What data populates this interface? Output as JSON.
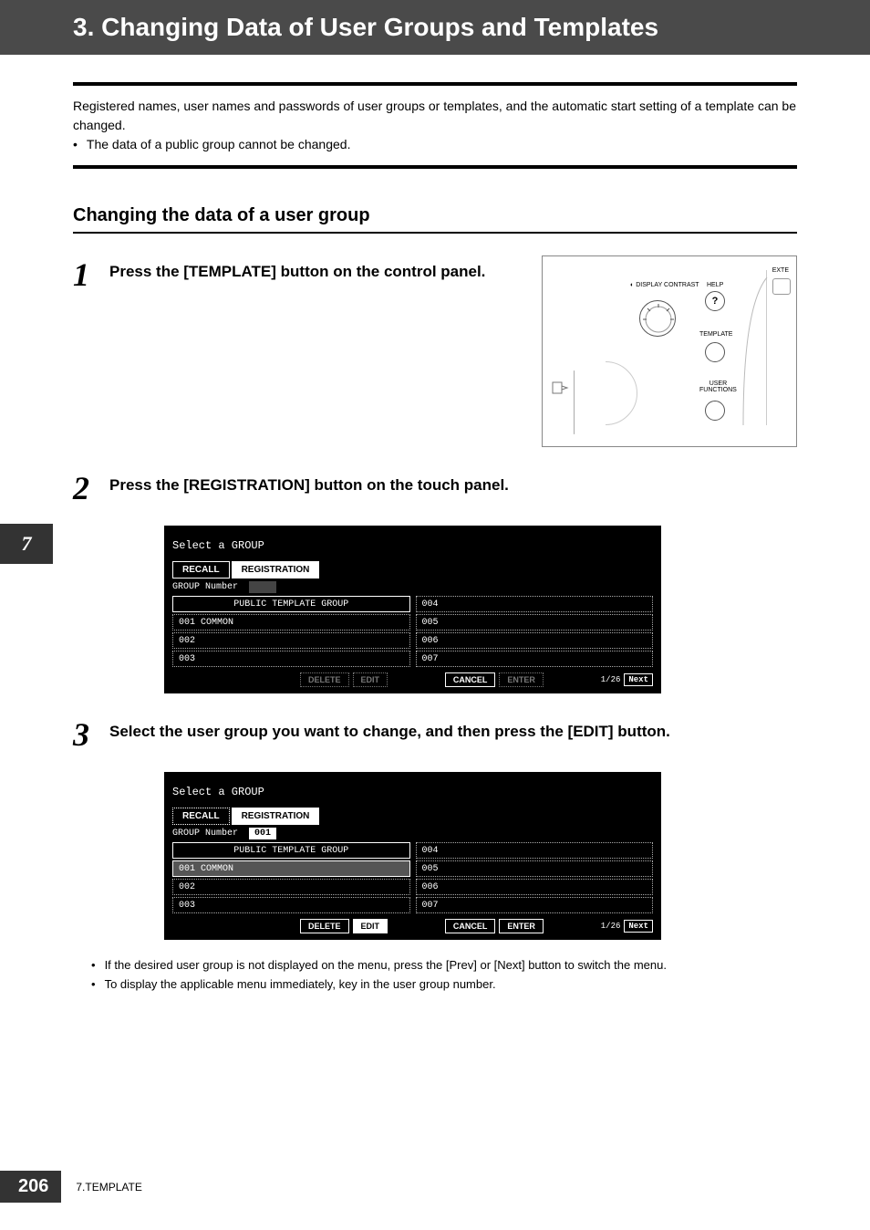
{
  "header": {
    "title": "3. Changing Data of User Groups and Templates"
  },
  "intro": {
    "p1": "Registered names, user names and passwords of user groups or templates, and the automatic start setting of a template can be changed.",
    "bullet1": "The data of a public group cannot be changed."
  },
  "subsection": {
    "title": "Changing the data of a user group"
  },
  "steps": {
    "s1": {
      "num": "1",
      "text": "Press the [TEMPLATE] button on the control panel."
    },
    "s2": {
      "num": "2",
      "text": "Press the [REGISTRATION] button on the touch panel."
    },
    "s3": {
      "num": "3",
      "text": "Select the user group you want to change, and then press the [EDIT] button."
    }
  },
  "controlPanel": {
    "displayContrast": "DISPLAY CONTRAST",
    "help": "HELP",
    "template": "TEMPLATE",
    "userFunctions": "USER\nFUNCTIONS",
    "exte": "EXTE",
    "question": "?"
  },
  "screenA": {
    "title": "Select a GROUP",
    "tabRecall": "RECALL",
    "tabRegistration": "REGISTRATION",
    "groupNumberLabel": "GROUP Number",
    "groupNumberVal": "",
    "leftHeader": "PUBLIC TEMPLATE GROUP",
    "leftRows": [
      "001 COMMON",
      "002",
      "003"
    ],
    "rightRows": [
      "004",
      "005",
      "006",
      "007"
    ],
    "btnDelete": "DELETE",
    "btnEdit": "EDIT",
    "btnCancel": "CANCEL",
    "btnEnter": "ENTER",
    "page": "1/26",
    "next": "Next"
  },
  "screenB": {
    "title": "Select a GROUP",
    "tabRecall": "RECALL",
    "tabRegistration": "REGISTRATION",
    "groupNumberLabel": "GROUP Number",
    "groupNumberVal": "001",
    "leftHeader": "PUBLIC TEMPLATE GROUP",
    "leftRows": [
      "001 COMMON",
      "002",
      "003"
    ],
    "rightRows": [
      "004",
      "005",
      "006",
      "007"
    ],
    "btnDelete": "DELETE",
    "btnEdit": "EDIT",
    "btnCancel": "CANCEL",
    "btnEnter": "ENTER",
    "page": "1/26",
    "next": "Next"
  },
  "notes": {
    "n1": "If the desired user group is not displayed on the menu, press the [Prev] or [Next] button to switch the menu.",
    "n2": "To display the applicable menu immediately, key in the user group number."
  },
  "sideTab": "7",
  "footer": {
    "pageNum": "206",
    "chapter": "7.TEMPLATE"
  }
}
